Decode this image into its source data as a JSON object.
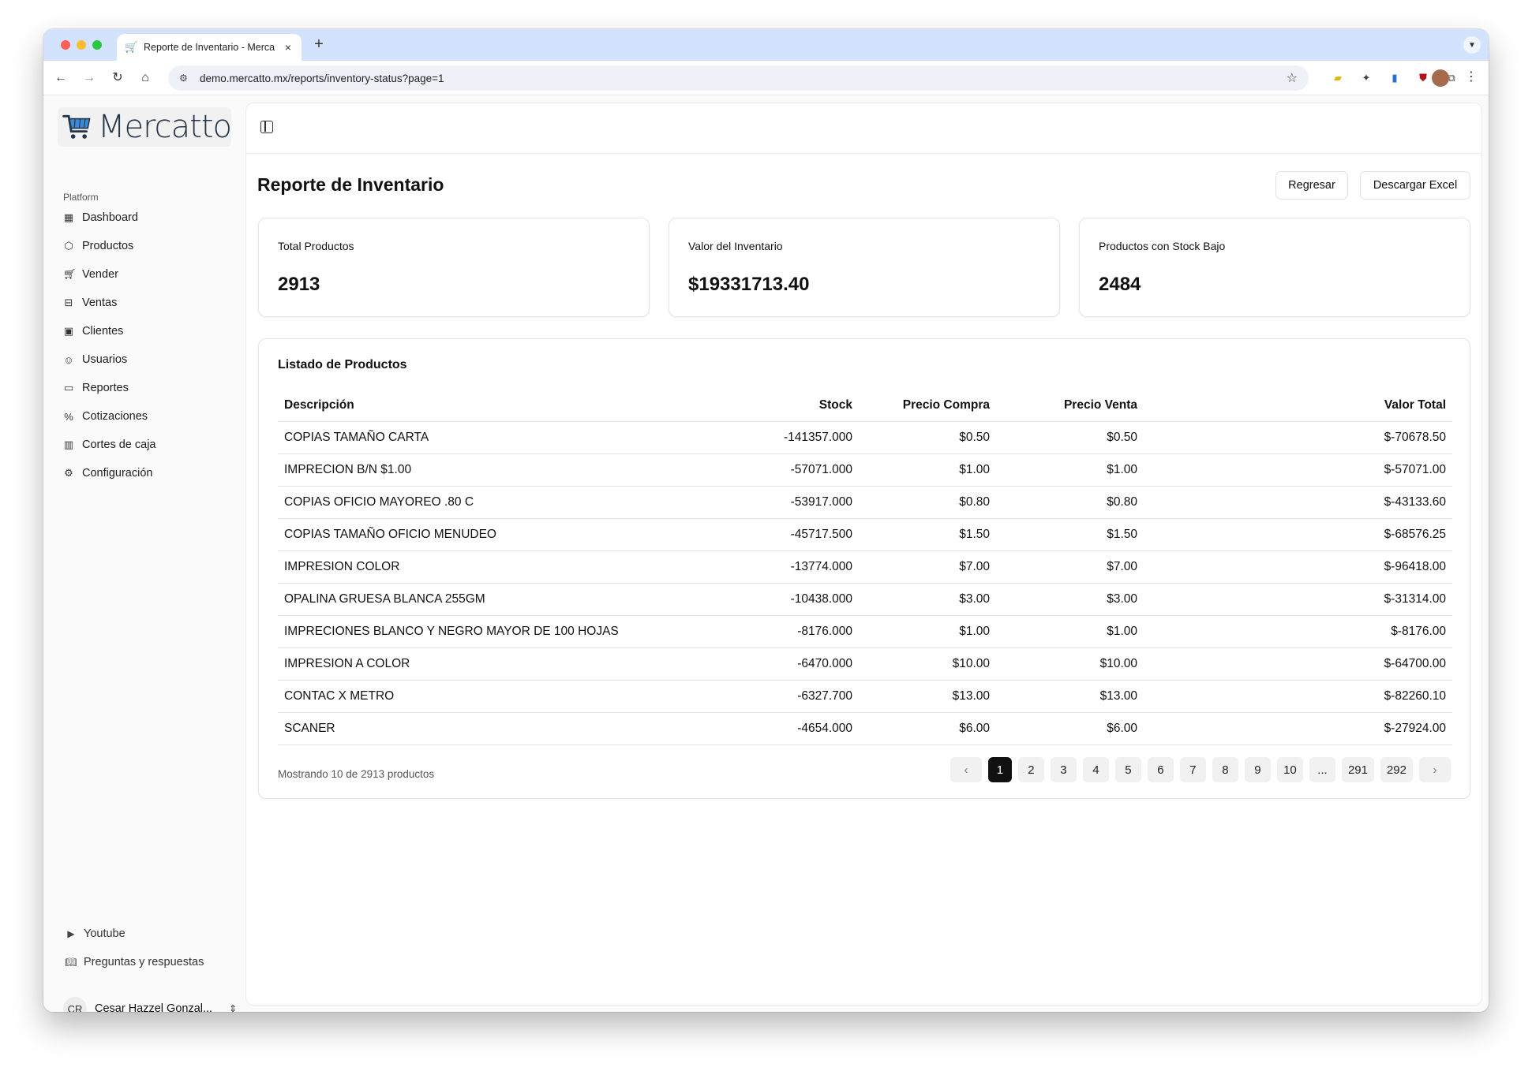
{
  "browser": {
    "tab_title": "Reporte de Inventario - Merca",
    "url": "demo.mercatto.mx/reports/inventory-status?page=1"
  },
  "sidebar": {
    "logo_text": "Mercatto",
    "section_label": "Platform",
    "items": [
      {
        "label": "Dashboard",
        "icon": "grid-icon"
      },
      {
        "label": "Productos",
        "icon": "package-icon"
      },
      {
        "label": "Vender",
        "icon": "cart-icon"
      },
      {
        "label": "Ventas",
        "icon": "basket-icon"
      },
      {
        "label": "Clientes",
        "icon": "contact-icon"
      },
      {
        "label": "Usuarios",
        "icon": "users-icon"
      },
      {
        "label": "Reportes",
        "icon": "clipboard-icon"
      },
      {
        "label": "Cotizaciones",
        "icon": "percent-icon"
      },
      {
        "label": "Cortes de caja",
        "icon": "chart-icon"
      },
      {
        "label": "Configuración",
        "icon": "gear-icon"
      }
    ],
    "bottom_links": [
      {
        "label": "Youtube",
        "icon": "youtube-icon"
      },
      {
        "label": "Preguntas y respuestas",
        "icon": "book-icon"
      }
    ],
    "user": {
      "initials": "CR",
      "name": "Cesar Hazzel Gonzal..."
    }
  },
  "page": {
    "title": "Reporte de Inventario",
    "back_button": "Regresar",
    "excel_button": "Descargar Excel"
  },
  "cards": [
    {
      "label": "Total Productos",
      "value": "2913"
    },
    {
      "label": "Valor del Inventario",
      "value": "$19331713.40"
    },
    {
      "label": "Productos con Stock Bajo",
      "value": "2484"
    }
  ],
  "table": {
    "title": "Listado de Productos",
    "headers": [
      "Descripción",
      "Stock",
      "Precio Compra",
      "Precio Venta",
      "Valor Total"
    ],
    "rows": [
      [
        "COPIAS TAMAÑO CARTA",
        "-141357.000",
        "$0.50",
        "$0.50",
        "$-70678.50"
      ],
      [
        "IMPRECION B/N $1.00",
        "-57071.000",
        "$1.00",
        "$1.00",
        "$-57071.00"
      ],
      [
        "COPIAS OFICIO MAYOREO .80 C",
        "-53917.000",
        "$0.80",
        "$0.80",
        "$-43133.60"
      ],
      [
        "COPIAS TAMAÑO OFICIO MENUDEO",
        "-45717.500",
        "$1.50",
        "$1.50",
        "$-68576.25"
      ],
      [
        "IMPRESION COLOR",
        "-13774.000",
        "$7.00",
        "$7.00",
        "$-96418.00"
      ],
      [
        "OPALINA GRUESA BLANCA 255GM",
        "-10438.000",
        "$3.00",
        "$3.00",
        "$-31314.00"
      ],
      [
        "IMPRECIONES BLANCO Y NEGRO MAYOR DE 100 HOJAS",
        "-8176.000",
        "$1.00",
        "$1.00",
        "$-8176.00"
      ],
      [
        "IMPRESION A COLOR",
        "-6470.000",
        "$10.00",
        "$10.00",
        "$-64700.00"
      ],
      [
        "CONTAC X METRO",
        "-6327.700",
        "$13.00",
        "$13.00",
        "$-82260.10"
      ],
      [
        "SCANER",
        "-4654.000",
        "$6.00",
        "$6.00",
        "$-27924.00"
      ]
    ],
    "showing_text": "Mostrando 10 de 2913 productos"
  },
  "pagination": {
    "prev": "‹",
    "next": "›",
    "pages": [
      "1",
      "2",
      "3",
      "4",
      "5",
      "6",
      "7",
      "8",
      "9",
      "10",
      "...",
      "291",
      "292"
    ],
    "current": "1"
  }
}
